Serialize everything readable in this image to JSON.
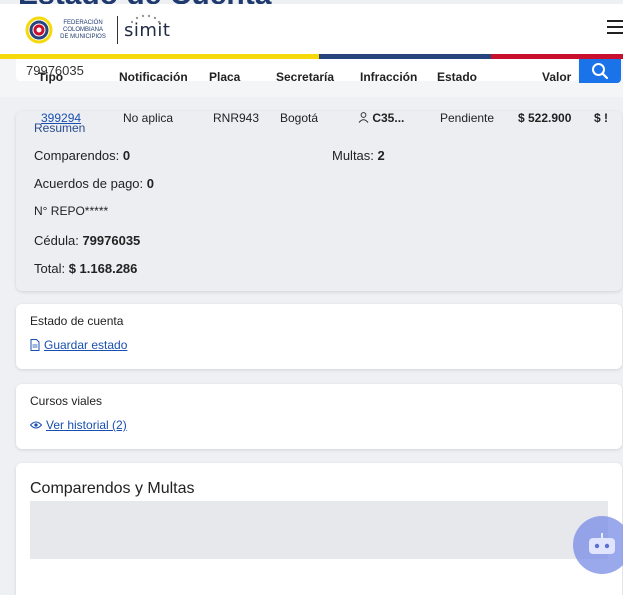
{
  "page": {
    "title": "Estado de Cuenta"
  },
  "header": {
    "fcm_lines": [
      "FEDERACIÓN",
      "COLOMBIANA",
      "DE MUNICIPIOS"
    ],
    "brand": "simit",
    "menu_icon": "hamburger-icon"
  },
  "flag_colors": {
    "yellow": "#f5d90a",
    "blue": "#27447c",
    "red": "#c8102e"
  },
  "search": {
    "value": "79976035",
    "button_icon": "search-icon"
  },
  "summary": {
    "title": "Resumen",
    "comparendos_label": "Comparendos:",
    "comparendos_value": "0",
    "multas_label": "Multas:",
    "multas_value": "2",
    "acuerdos_label": "Acuerdos de pago:",
    "acuerdos_value": "0",
    "repo_label": "N° REPO*****",
    "cedula_label": "Cédula:",
    "cedula_value": "79976035",
    "total_label": "Total:",
    "total_value": "$ 1.168.286"
  },
  "estado": {
    "title": "Estado de cuenta",
    "link": "Guardar estado",
    "icon": "document-icon"
  },
  "cursos": {
    "title": "Cursos viales",
    "link": "Ver historial (2)",
    "icon": "eye-icon"
  },
  "comparendos": {
    "title": "Comparendos y Multas",
    "columns": [
      "Tipo",
      "Notificación",
      "Placa",
      "Secretaría",
      "Infracción",
      "Estado",
      "Valor",
      "$"
    ],
    "row": {
      "tipo": "399294",
      "notificacion": "No aplica",
      "placa": "RNR943",
      "secretaria": "Bogotá",
      "infraccion": "C35...",
      "estado": "Pendiente",
      "valor": "$ 522.900",
      "extra": "$ !"
    }
  },
  "chatbot": {
    "icon": "chatbot-icon"
  }
}
